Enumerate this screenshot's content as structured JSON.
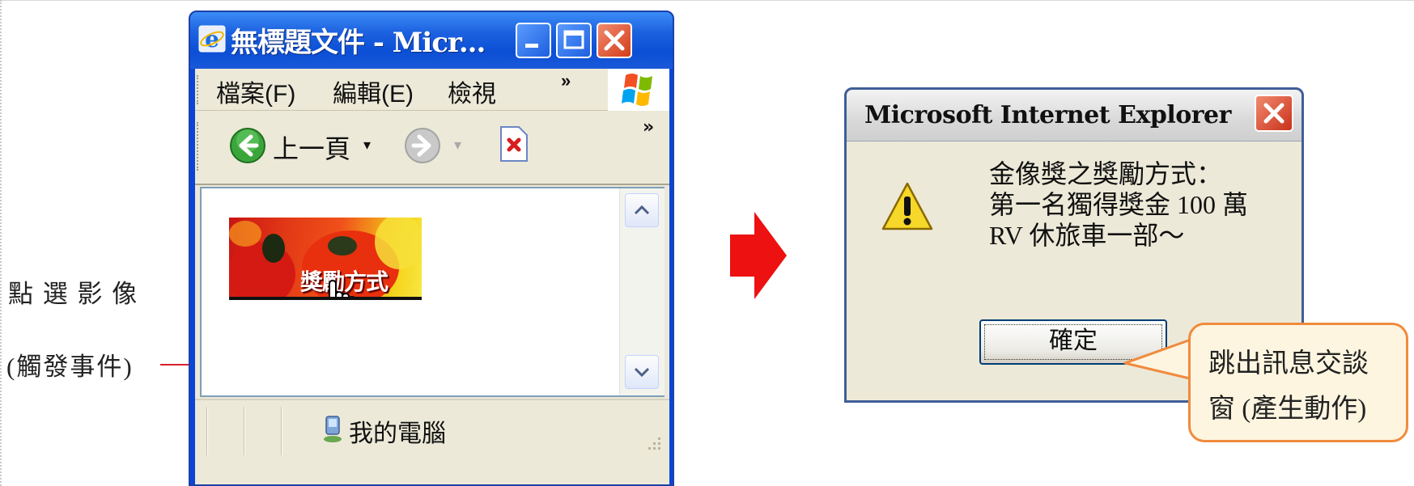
{
  "annotation": {
    "line1": "點 選 影 像",
    "line2": "(觸發事件)"
  },
  "browser": {
    "title": "無標題文件 - Micr...",
    "menu": [
      "檔案(F)",
      "編輯(E)",
      "檢視"
    ],
    "menu_more": "»",
    "toolbar": {
      "back_label": "上一頁",
      "dropdown_glyph": "▾",
      "more": "»"
    },
    "banner_text": "獎勵方式",
    "status_text": "我的電腦"
  },
  "dialog": {
    "title": "Microsoft Internet Explorer",
    "message_lines": [
      "金像獎之獎勵方式：",
      "第一名獨得獎金 100 萬",
      "RV 休旅車一部～"
    ],
    "ok_label": "確定"
  },
  "callout": {
    "line1": "跳出訊息交談",
    "line2": "窗 (產生動作)"
  },
  "icons": {
    "ie_logo": "ie-icon",
    "back": "back-arrow-icon",
    "forward": "forward-arrow-icon",
    "stop": "stop-icon",
    "warning": "warning-icon",
    "computer": "computer-icon",
    "hand": "hand-cursor-icon",
    "arrow": "right-arrow-icon"
  },
  "colors": {
    "xp_blue": "#0b4fd6",
    "arrow_red": "#ee1111",
    "callout_border": "#f08a3c",
    "annotation_line": "#d7202a"
  }
}
